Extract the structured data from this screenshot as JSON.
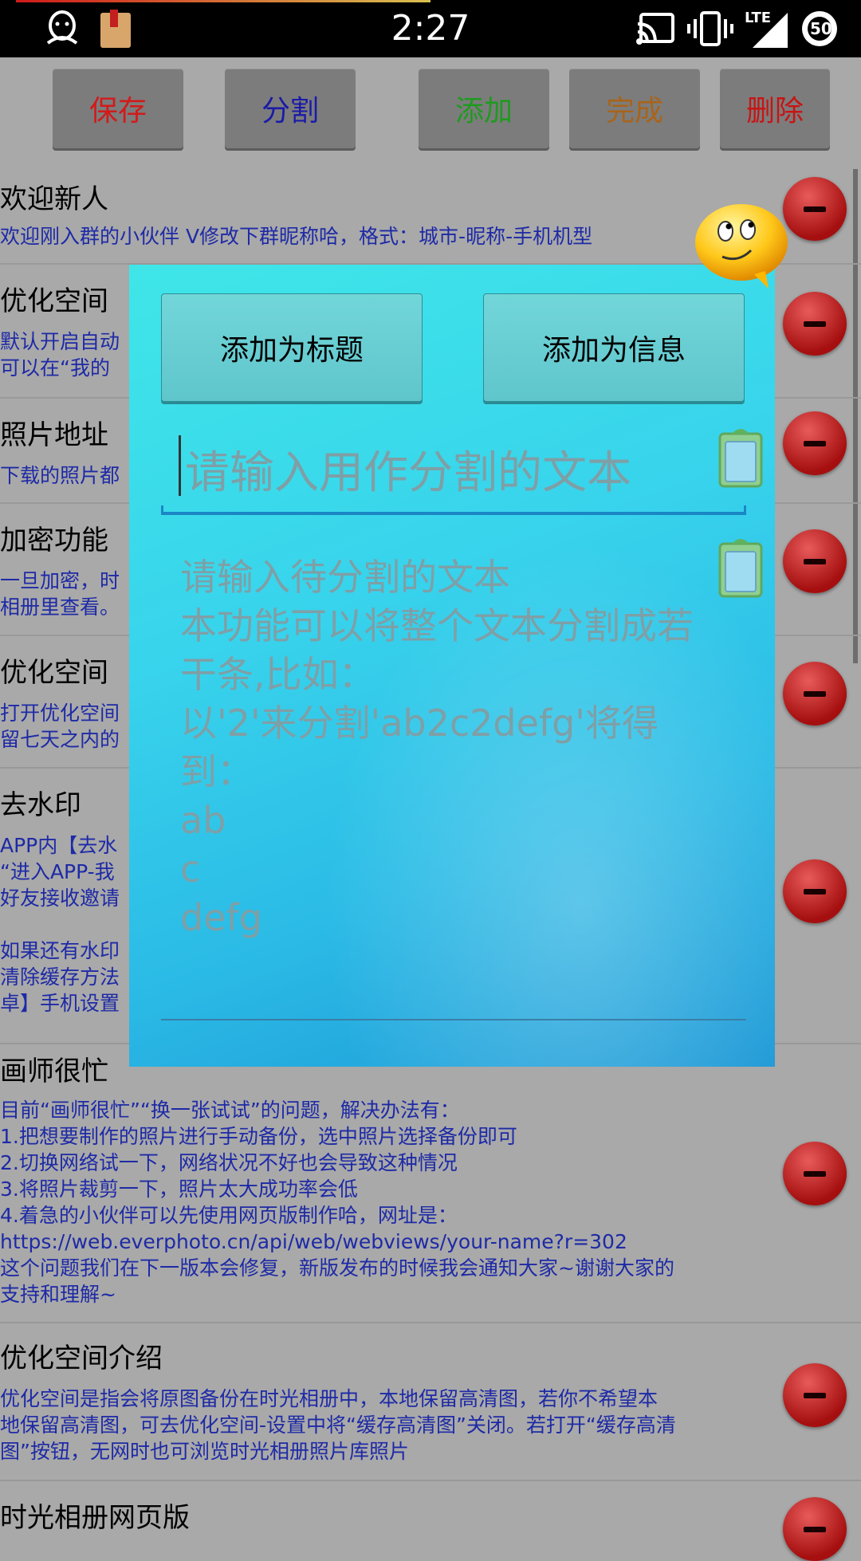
{
  "status_bar": {
    "time": "2:27",
    "network": "LTE",
    "battery": "50",
    "icons": [
      "qq-icon",
      "bookmark-bag-icon",
      "cast-icon",
      "vibrate-icon",
      "signal-icon",
      "battery-icon"
    ]
  },
  "toolbar": {
    "buttons": [
      {
        "label": "保存",
        "color": "#d21a1a"
      },
      {
        "label": "分割",
        "color": "#1a1aa8"
      },
      {
        "label": "添加",
        "color": "#1f9a1f"
      },
      {
        "label": "完成",
        "color": "#a8641a"
      },
      {
        "label": "删除",
        "color": "#c81414"
      }
    ]
  },
  "items": [
    {
      "title": "欢迎新人",
      "body": "欢迎刚入群的小伙伴 V修改下群昵称哈，格式：城市-昵称-手机机型"
    },
    {
      "title": "优化空间",
      "body": "默认开启自动\n可以在“我的"
    },
    {
      "title": "照片地址",
      "body": "下载的照片都"
    },
    {
      "title": "加密功能",
      "body": "一旦加密，时\n相册里查看。"
    },
    {
      "title": "优化空间",
      "body": "打开优化空间\n留七天之内的"
    },
    {
      "title": "去水印",
      "body": "APP内【去水\n“进入APP-我\n好友接收邀请\n\n如果还有水印\n清除缓存方法\n卓】手机设置"
    },
    {
      "title": "画师很忙",
      "body": "目前“画师很忙”“换一张试试”的问题，解决办法有：\n1.把想要制作的照片进行手动备份，选中照片选择备份即可\n2.切换网络试一下，网络状况不好也会导致这种情况\n3.将照片裁剪一下，照片太大成功率会低\n4.着急的小伙伴可以先使用网页版制作哈，网址是：\nhttps://web.everphoto.cn/api/web/webviews/your-name?r=302\n这个问题我们在下一版本会修复，新版发布的时候我会通知大家~谢谢大家的\n支持和理解~"
    },
    {
      "title": "优化空间介绍",
      "body": "优化空间是指会将原图备份在时光相册中，本地保留高清图，若你不希望本\n地保留高清图，可去优化空间-设置中将“缓存高清图”关闭。若打开“缓存高清\n图”按钮，无网时也可浏览时光相册照片库照片"
    },
    {
      "title": "时光相册网页版",
      "body": ""
    }
  ],
  "dialog": {
    "add_as_title": "添加为标题",
    "add_as_info": "添加为信息",
    "split_placeholder": "请输入用作分割的文本",
    "text_placeholder": "请输入待分割的文本\n本功能可以将整个文本分割成若干条,比如：\n以'2'来分割'ab2c2defg'将得到：\nab\nc\ndefg"
  }
}
